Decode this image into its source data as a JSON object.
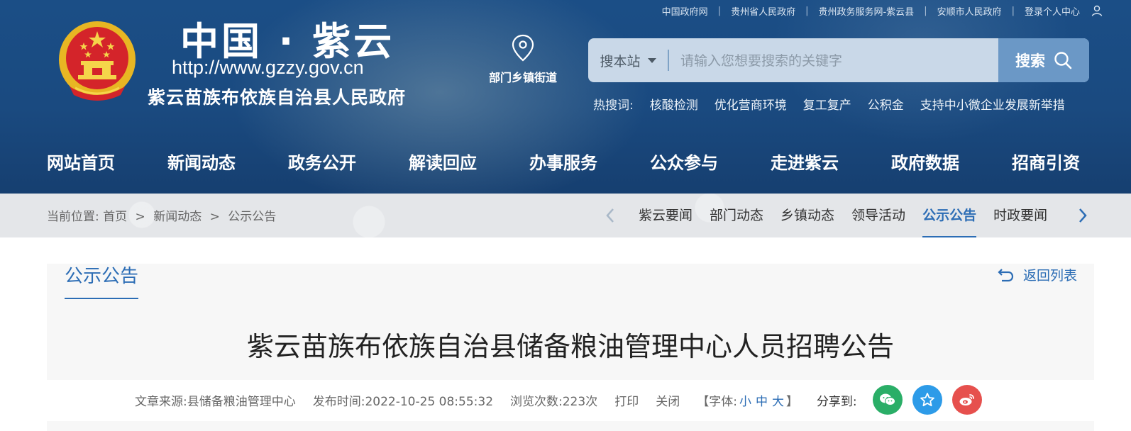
{
  "top_links": [
    "中国政府网",
    "贵州省人民政府",
    "贵州政务服务网-紫云县",
    "安顺市人民政府",
    "登录个人中心"
  ],
  "top_links_separator": "|",
  "site": {
    "title": "中国 · 紫云",
    "url": "http://www.gzzy.gov.cn",
    "org": "紫云苗族布依族自治县人民政府"
  },
  "dept_link": {
    "label": "部门乡镇街道",
    "icon": "location-pin-icon"
  },
  "search": {
    "scope": "搜本站",
    "placeholder": "请输入您想要搜索的关键字",
    "value": "",
    "button": "搜索"
  },
  "hot_words": {
    "label": "热搜词:",
    "items": [
      "核酸检测",
      "优化营商环境",
      "复工复产",
      "公积金",
      "支持中小微企业发展新举措"
    ]
  },
  "main_nav": [
    "网站首页",
    "新闻动态",
    "政务公开",
    "解读回应",
    "办事服务",
    "公众参与",
    "走进紫云",
    "政府数据",
    "招商引资"
  ],
  "breadcrumb": {
    "prefix": "当前位置:",
    "items": [
      "首页",
      "新闻动态",
      "公示公告"
    ],
    "separator": ">"
  },
  "sub_nav": {
    "items": [
      "紫云要闻",
      "部门动态",
      "乡镇动态",
      "领导活动",
      "公示公告",
      "时政要闻"
    ],
    "active": "公示公告"
  },
  "section": {
    "tab": "公示公告",
    "back": "返回列表"
  },
  "article": {
    "title": "紫云苗族布依族自治县储备粮油管理中心人员招聘公告",
    "source": "文章来源:县储备粮油管理中心",
    "publish_time": "发布时间:2022-10-25 08:55:32",
    "views": "浏览次数:223次",
    "print": "打印",
    "close": "关闭",
    "font_open": "【字体:",
    "font_small": "小",
    "font_medium": "中",
    "font_large": "大",
    "font_close": "】",
    "share_label": "分享到:"
  },
  "colors": {
    "header_blue": "#1b4e86",
    "accent": "#2c6db5",
    "wechat": "#2aae67",
    "qzone": "#2d9be8",
    "weibo": "#e6504d"
  }
}
